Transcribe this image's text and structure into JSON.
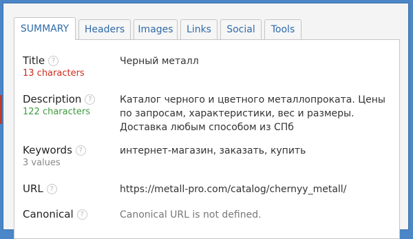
{
  "tabs": [
    {
      "label": "SUMMARY",
      "active": true
    },
    {
      "label": "Headers"
    },
    {
      "label": "Images"
    },
    {
      "label": "Links"
    },
    {
      "label": "Social"
    },
    {
      "label": "Tools"
    }
  ],
  "help_icon": "?",
  "rows": {
    "title": {
      "label": "Title",
      "sub": "13 characters",
      "value": "Черный металл"
    },
    "description": {
      "label": "Description",
      "sub": "122 characters",
      "value": "Каталог черного и цветного металлопроката. Цены по запросам, характеристики, вес и размеры. Доставка любым способом из СПб"
    },
    "keywords": {
      "label": "Keywords",
      "sub": "3 values",
      "value": "интернет-магазин, заказать, купить"
    },
    "url": {
      "label": "URL",
      "value": "https://metall-pro.com/catalog/chernyy_metall/"
    },
    "canonical": {
      "label": "Canonical",
      "value": "Canonical URL is not defined."
    }
  },
  "colors": {
    "background": "#4a86c8",
    "accent": "#2e6aa9",
    "error": "#cc2a1b",
    "ok": "#3e9b3e"
  }
}
